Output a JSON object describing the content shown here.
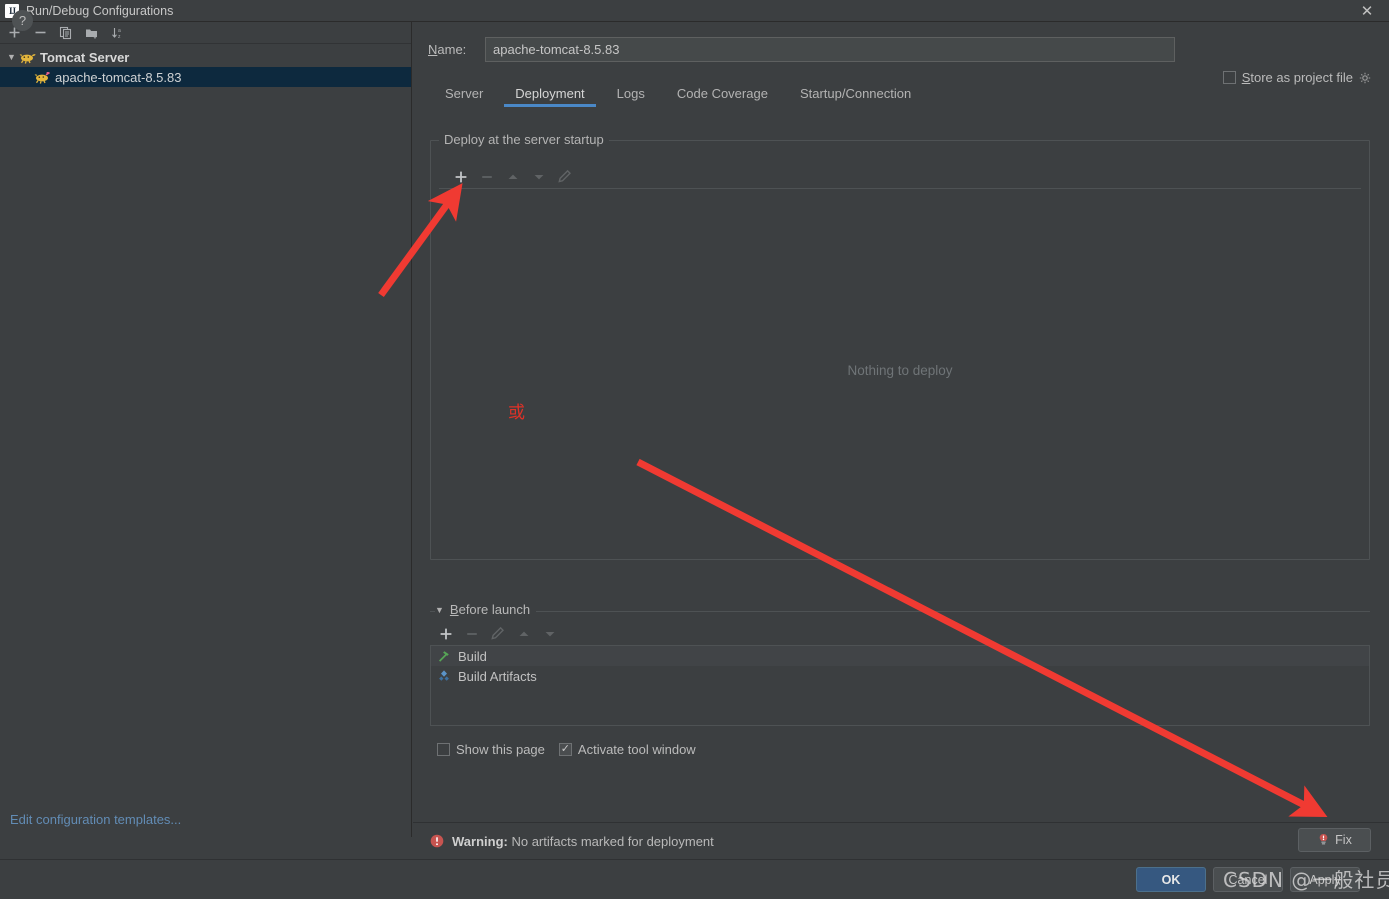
{
  "window": {
    "title": "Run/Debug Configurations",
    "app_icon": "intellij-idea-icon",
    "close_icon": "close-icon"
  },
  "sidebar": {
    "toolbar": [
      {
        "name": "add-configuration-button",
        "icon": "plus-icon"
      },
      {
        "name": "remove-configuration-button",
        "icon": "minus-icon"
      },
      {
        "name": "copy-configuration-button",
        "icon": "copy-icon"
      },
      {
        "name": "save-configuration-button",
        "icon": "folder-add-icon"
      },
      {
        "name": "sort-configurations-button",
        "icon": "sort-alpha-icon"
      }
    ],
    "tree": [
      {
        "label": "Tomcat Server",
        "type": "group",
        "expanded": true,
        "selected": false
      },
      {
        "label": "apache-tomcat-8.5.83",
        "type": "item",
        "selected": true
      }
    ],
    "edit_templates_link": "Edit configuration templates..."
  },
  "form": {
    "name_label": "Name:",
    "name_value": "apache-tomcat-8.5.83",
    "name_placeholder": "",
    "store_as_project_file": {
      "label": "Store as project file",
      "checked": false
    }
  },
  "tabs": [
    {
      "label": "Server",
      "active": false
    },
    {
      "label": "Deployment",
      "active": true
    },
    {
      "label": "Logs",
      "active": false
    },
    {
      "label": "Code Coverage",
      "active": false
    },
    {
      "label": "Startup/Connection",
      "active": false
    }
  ],
  "deployment": {
    "group_label": "Deploy at the server startup",
    "toolbar": [
      {
        "name": "add-artifact-button",
        "icon": "plus-icon",
        "enabled": true
      },
      {
        "name": "remove-artifact-button",
        "icon": "minus-icon",
        "enabled": false
      },
      {
        "name": "move-up-button",
        "icon": "arrow-up-icon",
        "enabled": false
      },
      {
        "name": "move-down-button",
        "icon": "arrow-down-icon",
        "enabled": false
      },
      {
        "name": "edit-artifact-button",
        "icon": "pencil-icon",
        "enabled": false
      }
    ],
    "empty_text": "Nothing to deploy"
  },
  "before_launch": {
    "title": "Before launch",
    "expanded": true,
    "toolbar": [
      {
        "name": "add-task-button",
        "icon": "plus-icon",
        "enabled": true
      },
      {
        "name": "remove-task-button",
        "icon": "minus-icon",
        "enabled": false
      },
      {
        "name": "edit-task-button",
        "icon": "pencil-icon",
        "enabled": false
      },
      {
        "name": "task-move-up-button",
        "icon": "arrow-up-icon",
        "enabled": false
      },
      {
        "name": "task-move-down-button",
        "icon": "arrow-down-icon",
        "enabled": false
      }
    ],
    "items": [
      {
        "label": "Build",
        "icon": "hammer-icon"
      },
      {
        "label": "Build Artifacts",
        "icon": "artifact-diamond-icon"
      }
    ],
    "options": [
      {
        "label": "Show this page",
        "checked": false
      },
      {
        "label": "Activate tool window",
        "checked": true
      }
    ]
  },
  "warning": {
    "icon": "error-circle-icon",
    "prefix": "Warning:",
    "message": "No artifacts marked for deployment",
    "fix_button": {
      "label": "Fix",
      "icon": "lightbulb-error-icon"
    }
  },
  "footer": {
    "help_button": "?",
    "ok_button": "OK",
    "cancel_button": "Cancel",
    "apply_button": "Apply"
  },
  "annotations": {
    "chinese_or": "或",
    "watermark": "CSDN @一般社员",
    "arrow_color": "#f03a32"
  },
  "colors": {
    "background": "#3c3f41",
    "selection": "#0d293e",
    "accent": "#4a88c7",
    "link": "#628cb5",
    "annotation_red": "#f03a32",
    "ok_button": "#365880"
  }
}
